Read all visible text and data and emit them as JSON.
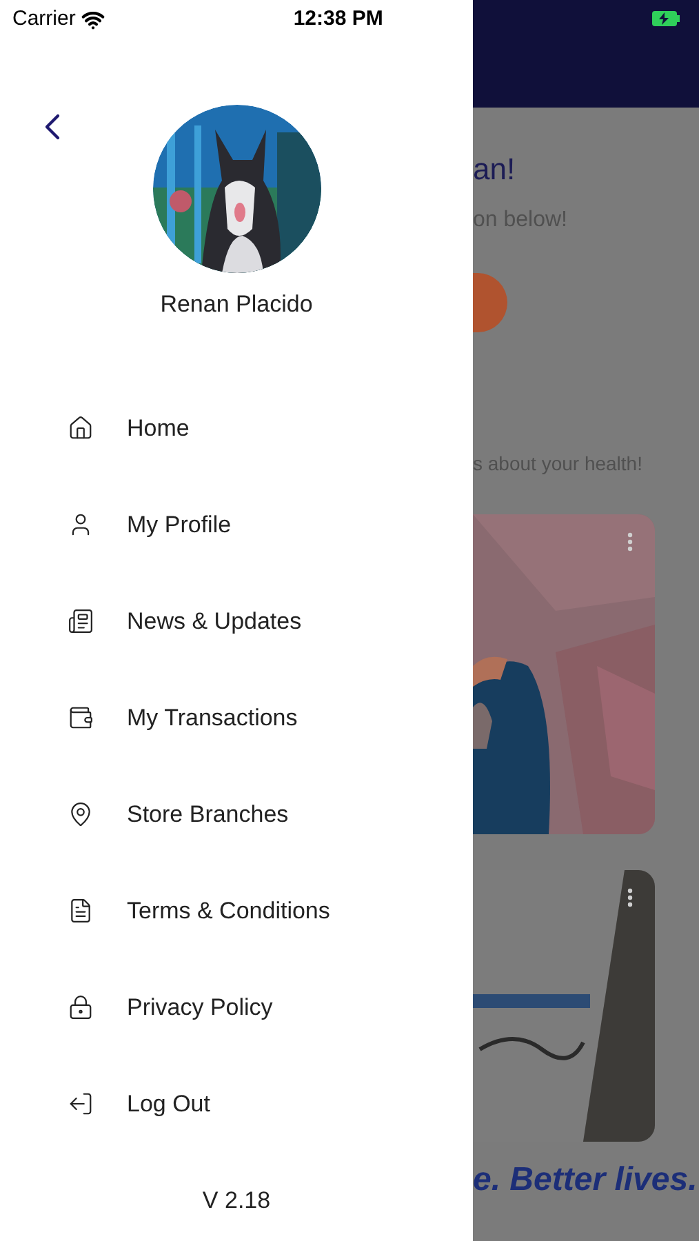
{
  "status_bar": {
    "carrier": "Carrier",
    "time": "12:38 PM"
  },
  "drawer": {
    "profile": {
      "name": "Renan Placido"
    },
    "menu": [
      {
        "label": "Home"
      },
      {
        "label": "My Profile"
      },
      {
        "label": "News & Updates"
      },
      {
        "label": "My Transactions"
      },
      {
        "label": "Store Branches"
      },
      {
        "label": "Terms & Conditions"
      },
      {
        "label": "Privacy Policy"
      },
      {
        "label": "Log Out"
      }
    ],
    "version": "V 2.18"
  },
  "background_screen": {
    "greeting": "an!",
    "subtitle": "on below!",
    "section_subtitle": "s about your health!",
    "slogan": "e. Better lives."
  }
}
